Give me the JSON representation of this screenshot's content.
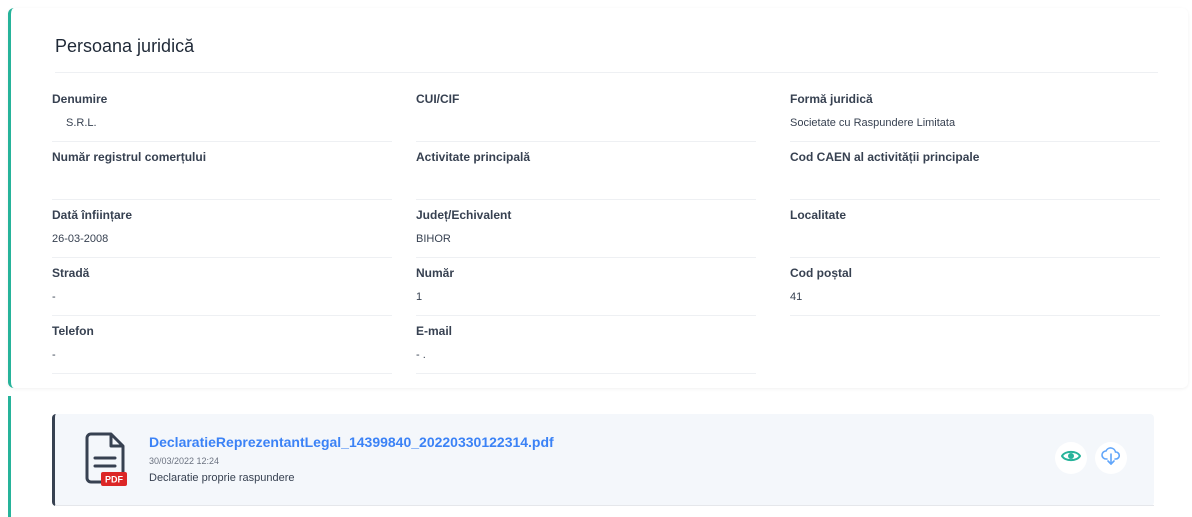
{
  "section": {
    "title": "Persoana juridică"
  },
  "fields": [
    {
      "label": "Denumire",
      "value": "S.R.L."
    },
    {
      "label": "CUI/CIF",
      "value": ""
    },
    {
      "label": "Formă juridică",
      "value": "Societate cu Raspundere Limitata"
    },
    {
      "label": "Număr registrul comerțului",
      "value": ""
    },
    {
      "label": "Activitate principală",
      "value": ""
    },
    {
      "label": "Cod CAEN al activității principale",
      "value": ""
    },
    {
      "label": "Dată înființare",
      "value": "26-03-2008"
    },
    {
      "label": "Județ/Echivalent",
      "value": "BIHOR"
    },
    {
      "label": "Localitate",
      "value": ""
    },
    {
      "label": "Stradă",
      "value": "-"
    },
    {
      "label": "Număr",
      "value": "1"
    },
    {
      "label": "Cod poștal",
      "value": "41"
    },
    {
      "label": "Telefon",
      "value": "-"
    },
    {
      "label": "E-mail",
      "value": "- ."
    }
  ],
  "document": {
    "filename": "DeclaratieReprezentantLegal_14399840_20220330122314.pdf",
    "date": "30/03/2022 12:24",
    "description": "Declaratie proprie raspundere",
    "badge": "PDF",
    "icon": "pdf-file-icon"
  },
  "actions": {
    "view_icon": "eye-icon",
    "download_icon": "cloud-download-icon"
  },
  "colors": {
    "accent": "#26b39a",
    "link": "#3b82f6",
    "pdf_badge": "#dc2626"
  }
}
